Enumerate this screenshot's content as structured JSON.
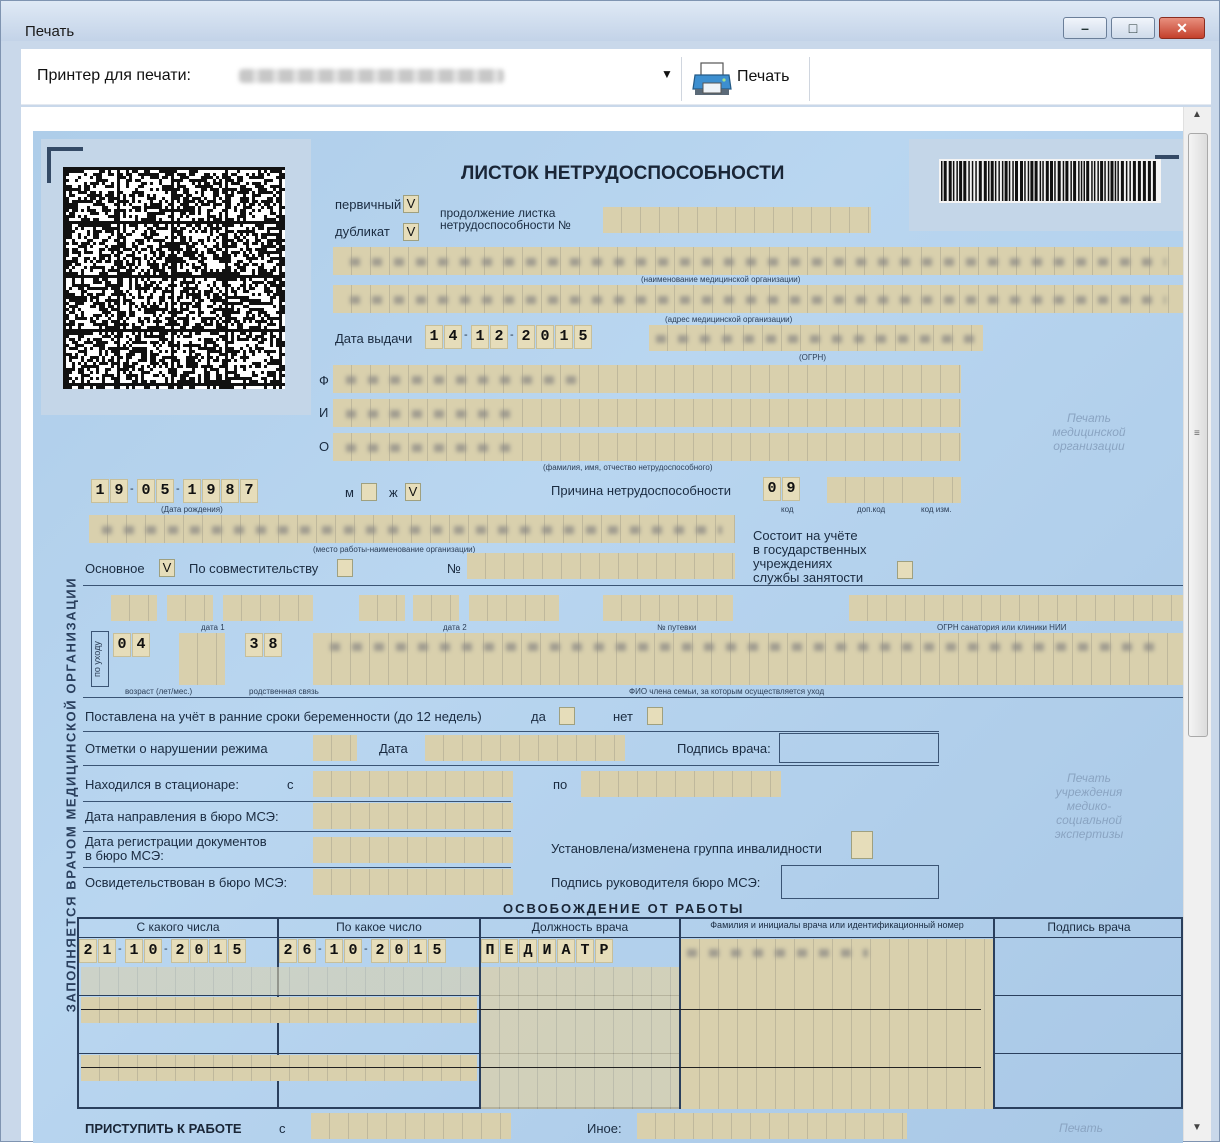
{
  "window": {
    "title": "Печать"
  },
  "window_buttons": {
    "min": "–",
    "max": "□",
    "close": "✕"
  },
  "toolbar": {
    "printer_label": "Принтер для печати:",
    "print_label": "Печать",
    "icons": {
      "dropdown": "chevron-down-icon",
      "print": "printer-icon"
    }
  },
  "scrollbar": {
    "up": "▲",
    "down": "▼",
    "grip": "≡"
  },
  "form": {
    "title": "ЛИСТОК НЕТРУДОСПОСОБНОСТИ",
    "primary_label": "первичный",
    "primary_mark": "V",
    "duplicate_label": "дубликат",
    "duplicate_mark": "V",
    "continuation_label_1": "продолжение листка",
    "continuation_label_2": "нетрудоспособности №",
    "org_name_caption": "(наименование медицинской организации)",
    "org_address_caption": "(адрес медицинской организации)",
    "issue_date_label": "Дата выдачи",
    "issue_date": [
      "1",
      "4",
      "1",
      "2",
      "2",
      "0",
      "1",
      "5"
    ],
    "ogrn_caption": "(ОГРН)",
    "f_label": "Ф",
    "i_label": "И",
    "o_label": "О",
    "fio_caption": "(фамилия, имя, отчество нетрудоспособного)",
    "stamp_org": "Печать\nмедицинской\nорганизации",
    "birth_date": [
      "1",
      "9",
      "0",
      "5",
      "1",
      "9",
      "8",
      "7"
    ],
    "birth_caption": "(Дата рождения)",
    "male_label": "м",
    "female_label": "ж",
    "female_mark": "V",
    "reason_label": "Причина нетрудоспособности",
    "reason_code": [
      "0",
      "9"
    ],
    "reason_code_caption": "код",
    "extra_code_caption": "доп.код",
    "code_change_caption": "код изм.",
    "workplace_caption": "(место работы-наименование организации)",
    "employment_label_1": "Состоит на учёте",
    "employment_label_2": "в государственных",
    "employment_label_3": "учреждениях",
    "employment_label_4": "службы занятости",
    "main_label": "Основное",
    "main_mark": "V",
    "part_time_label": "По совместительству",
    "number_label": "№",
    "date1_caption": "дата 1",
    "date2_caption": "дата 2",
    "voucher_caption": "№ путевки",
    "sanatorium_caption": "ОГРН санатория или клиники НИИ",
    "care_vertical": "по уходу",
    "care_age": [
      "0",
      "4"
    ],
    "care_relation": [
      "3",
      "8"
    ],
    "age_caption": "возраст (лет/мес.)",
    "relation_caption": "родственная связь",
    "family_caption": "ФИО члена семьи, за которым осуществляется уход",
    "pregnancy_label": "Поставлена на учёт в ранние сроки беременности (до 12 недель)",
    "yes_label": "да",
    "no_label": "нет",
    "violation_label": "Отметки о нарушении режима",
    "date_label": "Дата",
    "doctor_signature_label": "Подпись врача:",
    "hospital_label": "Находился в стационаре:",
    "from_label": "с",
    "to_label": "по",
    "mse_direction_label": "Дата направления в бюро МСЭ:",
    "mse_reg_label_1": "Дата регистрации документов",
    "mse_reg_label_2": "в бюро МСЭ:",
    "disability_group_label": "Установлена/изменена группа инвалидности",
    "mse_exam_label": "Освидетельствован в бюро МСЭ:",
    "mse_head_signature_label": "Подпись руководителя бюро МСЭ:",
    "stamp_mse": "Печать\nучреждения\nмедико-\nсоциальной\nэкспертизы",
    "vertical_side": "ЗАПОЛНЯЕТСЯ ВРАЧОМ МЕДИЦИНСКОЙ ОРГАНИЗАЦИИ",
    "release_title": "ОСВОБОЖДЕНИЕ ОТ РАБОТЫ",
    "release_headers": [
      "С какого числа",
      "По какое число",
      "Должность врача",
      "Фамилия и инициалы врача или идентификационный номер",
      "Подпись врача"
    ],
    "release_from": [
      "2",
      "1",
      "1",
      "0",
      "2",
      "0",
      "1",
      "5"
    ],
    "release_to": [
      "2",
      "6",
      "1",
      "0",
      "2",
      "0",
      "1",
      "5"
    ],
    "release_position": [
      "П",
      "Е",
      "Д",
      "И",
      "А",
      "Т",
      "Р"
    ],
    "return_label": "ПРИСТУПИТЬ К РАБОТЕ",
    "return_from": "с",
    "other_label": "Иное:",
    "stamp_bottom": "Печать"
  }
}
